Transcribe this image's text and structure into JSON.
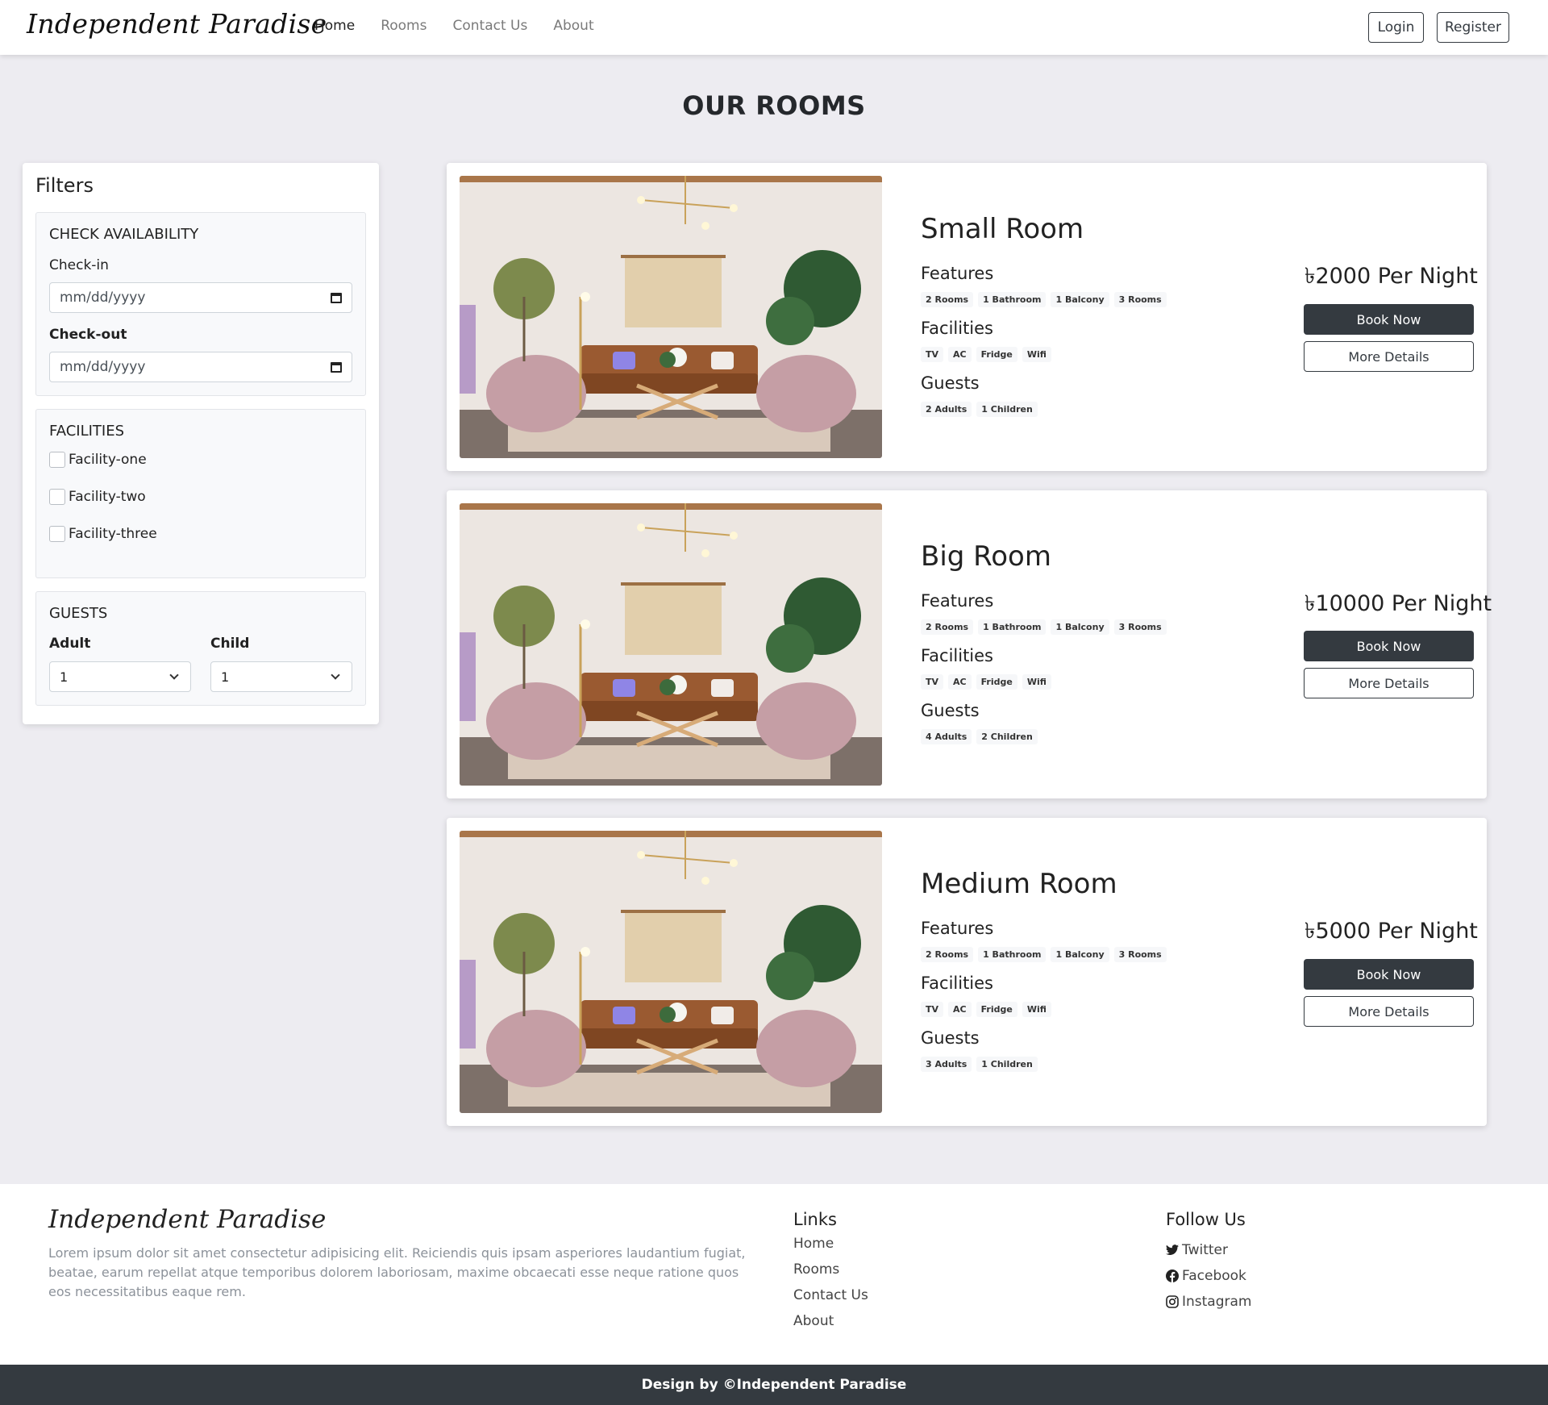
{
  "nav": {
    "brand": "Independent Paradise",
    "links": [
      "Home",
      "Rooms",
      "Contact Us",
      "About"
    ],
    "login": "Login",
    "register": "Register"
  },
  "page_title": "OUR ROOMS",
  "filters": {
    "title": "Filters",
    "availability": {
      "heading": "CHECK AVAILABILITY",
      "checkin_label": "Check-in",
      "checkin_value": "mm/dd/yyyy",
      "checkout_label": "Check-out",
      "checkout_value": "mm/dd/yyyy"
    },
    "facilities": {
      "heading": "FACILITIES",
      "options": [
        "Facility-one",
        "Facility-two",
        "Facility-three"
      ]
    },
    "guests": {
      "heading": "GUESTS",
      "adult_label": "Adult",
      "adult_value": "1",
      "child_label": "Child",
      "child_value": "1"
    }
  },
  "section_labels": {
    "features": "Features",
    "facilities": "Facilities",
    "guests": "Guests"
  },
  "rooms": [
    {
      "name": "Small Room",
      "features": [
        "2 Rooms",
        "1 Bathroom",
        "1 Balcony",
        "3 Rooms"
      ],
      "facilities": [
        "TV",
        "AC",
        "Fridge",
        "Wifi"
      ],
      "guests": [
        "2 Adults",
        "1 Children"
      ],
      "price": "৳2000 Per Night",
      "book": "Book Now",
      "details": "More Details"
    },
    {
      "name": "Big Room",
      "features": [
        "2 Rooms",
        "1 Bathroom",
        "1 Balcony",
        "3 Rooms"
      ],
      "facilities": [
        "TV",
        "AC",
        "Fridge",
        "Wifi"
      ],
      "guests": [
        "4 Adults",
        "2 Children"
      ],
      "price": "৳10000 Per Night",
      "book": "Book Now",
      "details": "More Details"
    },
    {
      "name": "Medium Room",
      "features": [
        "2 Rooms",
        "1 Bathroom",
        "1 Balcony",
        "3 Rooms"
      ],
      "facilities": [
        "TV",
        "AC",
        "Fridge",
        "Wifi"
      ],
      "guests": [
        "3 Adults",
        "1 Children"
      ],
      "price": "৳5000 Per Night",
      "book": "Book Now",
      "details": "More Details"
    }
  ],
  "footer": {
    "brand": "Independent Paradise",
    "description": "Lorem ipsum dolor sit amet consectetur adipisicing elit. Reiciendis quis ipsam asperiores laudantium fugiat, beatae, earum repellat atque temporibus dolorem laboriosam, maxime obcaecati esse neque ratione quos eos necessitatibus eaque rem.",
    "links_heading": "Links",
    "links": [
      "Home",
      "Rooms",
      "Contact Us",
      "About"
    ],
    "follow_heading": "Follow Us",
    "social": [
      {
        "label": "Twitter",
        "icon": "twitter-icon"
      },
      {
        "label": "Facebook",
        "icon": "facebook-icon"
      },
      {
        "label": "Instagram",
        "icon": "instagram-icon"
      }
    ],
    "copyright": "Design by ©Independent Paradise"
  },
  "colors": {
    "dark": "#343a40",
    "page_bg": "#edecf1",
    "muted": "#8c929a"
  }
}
